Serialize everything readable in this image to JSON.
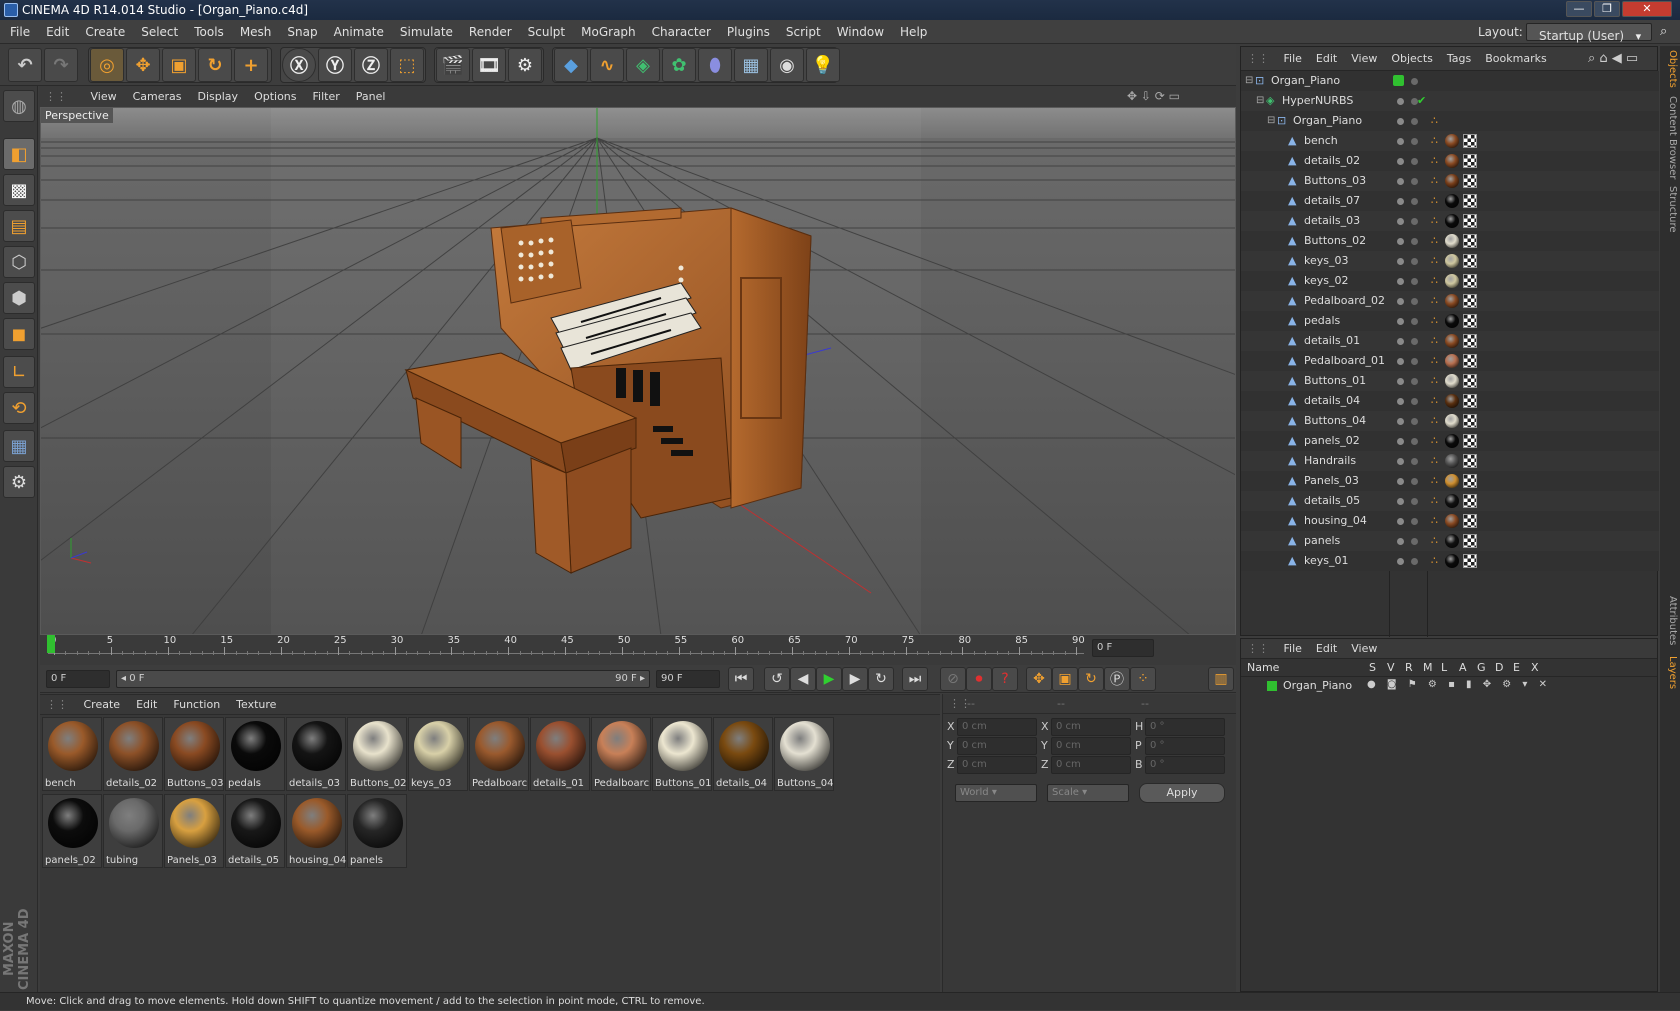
{
  "window": {
    "title": "CINEMA 4D R14.014 Studio - [Organ_Piano.c4d]",
    "controls": [
      "—",
      "❐",
      "✕"
    ]
  },
  "menu": [
    "File",
    "Edit",
    "Create",
    "Select",
    "Tools",
    "Mesh",
    "Snap",
    "Animate",
    "Simulate",
    "Render",
    "Sculpt",
    "MoGraph",
    "Character",
    "Plugins",
    "Script",
    "Window",
    "Help"
  ],
  "layout": {
    "label": "Layout:",
    "value": "Startup (User)"
  },
  "viewport": {
    "menu": [
      "View",
      "Cameras",
      "Display",
      "Options",
      "Filter",
      "Panel"
    ],
    "label": "Perspective"
  },
  "timeline": {
    "ticks": [
      "0",
      "5",
      "10",
      "15",
      "20",
      "25",
      "30",
      "35",
      "40",
      "45",
      "50",
      "55",
      "60",
      "65",
      "70",
      "75",
      "80",
      "85",
      "90"
    ],
    "current": "0 F"
  },
  "playback": {
    "start": "0 F",
    "range_start": "◂ 0 F",
    "range_end": "90 F ▸",
    "end": "90 F"
  },
  "materials": {
    "menu": [
      "Create",
      "Edit",
      "Function",
      "Texture"
    ],
    "items": [
      {
        "name": "bench",
        "color": "#9a5a2a"
      },
      {
        "name": "details_02",
        "color": "#8d5128"
      },
      {
        "name": "Buttons_03",
        "color": "#8a4a22"
      },
      {
        "name": "pedals",
        "color": "#0a0a0a"
      },
      {
        "name": "details_03",
        "color": "#141414"
      },
      {
        "name": "Buttons_02",
        "color": "#e8e2cc"
      },
      {
        "name": "keys_03",
        "color": "#d8d0a8"
      },
      {
        "name": "Pedalboarc",
        "color": "#9a5a2e"
      },
      {
        "name": "details_01",
        "color": "#9a5030"
      },
      {
        "name": "Pedalboarc",
        "color": "#c88058"
      },
      {
        "name": "Buttons_01",
        "color": "#ece6d0"
      },
      {
        "name": "details_04",
        "color": "#7a4a10"
      },
      {
        "name": "Buttons_04",
        "color": "#e4e0d2"
      },
      {
        "name": "panels_02",
        "color": "#0c0c0c"
      },
      {
        "name": "tubing",
        "color": "#6a6a6a"
      },
      {
        "name": "Panels_03",
        "color": "#d8a040"
      },
      {
        "name": "details_05",
        "color": "#181818"
      },
      {
        "name": "housing_04",
        "color": "#9a5a2a"
      },
      {
        "name": "panels",
        "color": "#262626"
      }
    ]
  },
  "coords": {
    "headers": [
      "--",
      "--",
      "--"
    ],
    "rows": [
      {
        "a": "X",
        "av": "0 cm",
        "b": "X",
        "bv": "0 cm",
        "c": "H",
        "cv": "0 °"
      },
      {
        "a": "Y",
        "av": "0 cm",
        "b": "Y",
        "bv": "0 cm",
        "c": "P",
        "cv": "0 °"
      },
      {
        "a": "Z",
        "av": "0 cm",
        "b": "Z",
        "bv": "0 cm",
        "c": "B",
        "cv": "0 °"
      }
    ],
    "space": "World",
    "mode": "Scale",
    "apply": "Apply"
  },
  "objects": {
    "menu": [
      "File",
      "Edit",
      "View",
      "Objects",
      "Tags",
      "Bookmarks"
    ],
    "tree": [
      {
        "name": "Organ_Piano",
        "level": 0,
        "kind": "null"
      },
      {
        "name": "HyperNURBS",
        "level": 1,
        "kind": "nurbs"
      },
      {
        "name": "Organ_Piano",
        "level": 2,
        "kind": "null"
      },
      {
        "name": "bench",
        "level": 3,
        "kind": "poly",
        "tag": "#8a4a22"
      },
      {
        "name": "details_02",
        "level": 3,
        "kind": "poly",
        "tag": "#8a4a22"
      },
      {
        "name": "Buttons_03",
        "level": 3,
        "kind": "poly",
        "tag": "#7a3f1a"
      },
      {
        "name": "details_07",
        "level": 3,
        "kind": "poly",
        "tag": "#0a0a0a"
      },
      {
        "name": "details_03",
        "level": 3,
        "kind": "poly",
        "tag": "#0a0a0a"
      },
      {
        "name": "Buttons_02",
        "level": 3,
        "kind": "poly",
        "tag": "#e0dccc"
      },
      {
        "name": "keys_03",
        "level": 3,
        "kind": "poly",
        "tag": "#d0c8a0"
      },
      {
        "name": "keys_02",
        "level": 3,
        "kind": "poly",
        "tag": "#d0c8a0"
      },
      {
        "name": "Pedalboard_02",
        "level": 3,
        "kind": "poly",
        "tag": "#8a4a22"
      },
      {
        "name": "pedals",
        "level": 3,
        "kind": "poly",
        "tag": "#0a0a0a"
      },
      {
        "name": "details_01",
        "level": 3,
        "kind": "poly",
        "tag": "#8a4a22"
      },
      {
        "name": "Pedalboard_01",
        "level": 3,
        "kind": "poly",
        "tag": "#b87050"
      },
      {
        "name": "Buttons_01",
        "level": 3,
        "kind": "poly",
        "tag": "#e0dccc"
      },
      {
        "name": "details_04",
        "level": 3,
        "kind": "poly",
        "tag": "#5a3010"
      },
      {
        "name": "Buttons_04",
        "level": 3,
        "kind": "poly",
        "tag": "#e0dccc"
      },
      {
        "name": "panels_02",
        "level": 3,
        "kind": "poly",
        "tag": "#0a0a0a"
      },
      {
        "name": "Handrails",
        "level": 3,
        "kind": "poly",
        "tag": "#555555"
      },
      {
        "name": "Panels_03",
        "level": 3,
        "kind": "poly",
        "tag": "#d09030"
      },
      {
        "name": "details_05",
        "level": 3,
        "kind": "poly",
        "tag": "#111111"
      },
      {
        "name": "housing_04",
        "level": 3,
        "kind": "poly",
        "tag": "#8a4a22"
      },
      {
        "name": "panels",
        "level": 3,
        "kind": "poly",
        "tag": "#111111"
      },
      {
        "name": "keys_01",
        "level": 3,
        "kind": "poly",
        "tag": "#0a0a0a"
      }
    ]
  },
  "layers": {
    "menu": [
      "File",
      "Edit",
      "View"
    ],
    "columns": [
      "Name",
      "S",
      "V",
      "R",
      "M",
      "L",
      "A",
      "G",
      "D",
      "E",
      "X"
    ],
    "rows": [
      {
        "name": "Organ_Piano",
        "color": "#30c030"
      }
    ]
  },
  "sidetabs": [
    "Objects",
    "Content Browser",
    "Structure",
    "Attributes",
    "Layers"
  ],
  "brand": "MAXON CINEMA 4D",
  "status": "Move: Click and drag to move elements. Hold down SHIFT to quantize movement / add to the selection in point mode, CTRL to remove."
}
